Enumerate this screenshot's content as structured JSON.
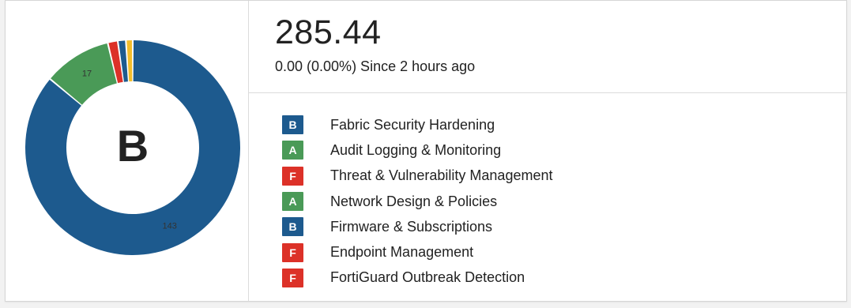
{
  "colors": {
    "B": "#1d5a8e",
    "A": "#4a9a57",
    "F": "#dc3128",
    "C": "#f2bd2c"
  },
  "donut": {
    "center_grade": "B",
    "segments": [
      {
        "grade": "B",
        "value": 143,
        "label": "143"
      },
      {
        "grade": "A",
        "value": 17,
        "label": "17"
      },
      {
        "grade": "F",
        "value": 2.5,
        "label": ""
      },
      {
        "grade": "B",
        "value": 2.0,
        "label": ""
      },
      {
        "grade": "C",
        "value": 1.7,
        "label": ""
      }
    ]
  },
  "score": {
    "value": "285.44",
    "change": "0.00 (0.00%) Since 2 hours ago"
  },
  "legend": [
    {
      "grade": "B",
      "label": "Fabric Security Hardening"
    },
    {
      "grade": "A",
      "label": "Audit Logging & Monitoring"
    },
    {
      "grade": "F",
      "label": "Threat & Vulnerability Management"
    },
    {
      "grade": "A",
      "label": "Network Design & Policies"
    },
    {
      "grade": "B",
      "label": "Firmware & Subscriptions"
    },
    {
      "grade": "F",
      "label": "Endpoint Management"
    },
    {
      "grade": "F",
      "label": "FortiGuard Outbreak Detection"
    }
  ]
}
